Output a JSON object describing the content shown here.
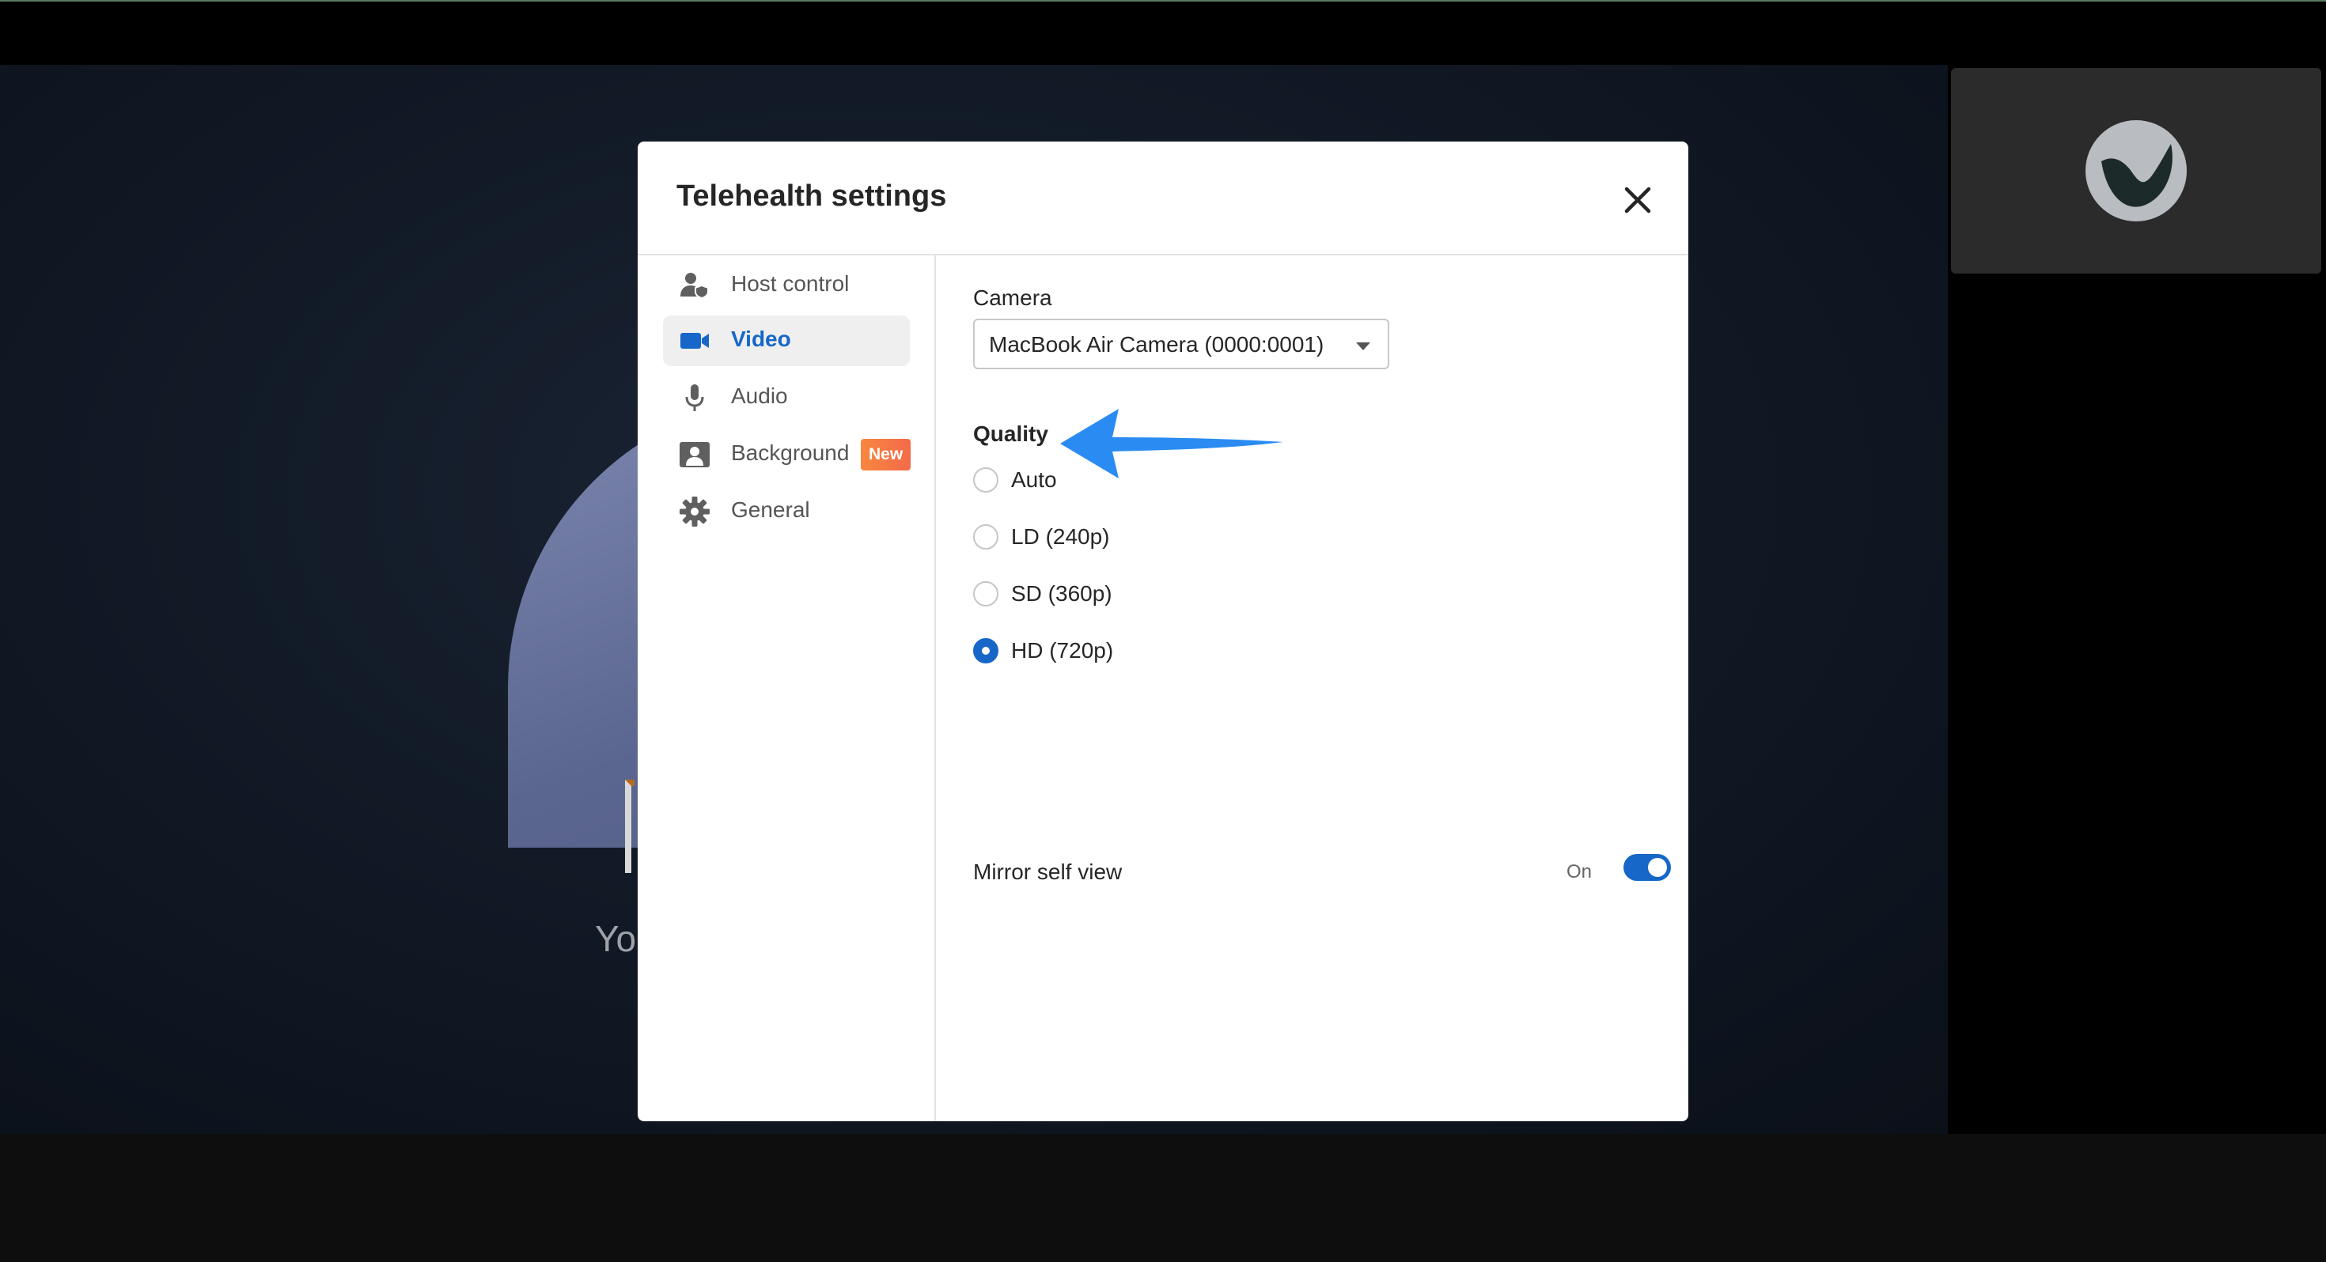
{
  "background": {
    "caption_fragment": "Yo"
  },
  "modal": {
    "title": "Telehealth settings"
  },
  "sidebar": {
    "items": [
      {
        "label": "Host control",
        "icon": "host-control-icon",
        "active": false
      },
      {
        "label": "Video",
        "icon": "video-camera-icon",
        "active": true
      },
      {
        "label": "Audio",
        "icon": "microphone-icon",
        "active": false
      },
      {
        "label": "Background",
        "icon": "background-portrait-icon",
        "active": false,
        "badge": "New"
      },
      {
        "label": "General",
        "icon": "gear-icon",
        "active": false
      }
    ]
  },
  "video": {
    "camera_label": "Camera",
    "camera_value": "MacBook Air Camera (0000:0001)",
    "quality_label": "Quality",
    "quality_options": [
      {
        "label": "Auto",
        "checked": false
      },
      {
        "label": "LD (240p)",
        "checked": false
      },
      {
        "label": "SD (360p)",
        "checked": false
      },
      {
        "label": "HD (720p)",
        "checked": true
      }
    ],
    "mirror_label": "Mirror self view",
    "mirror_state": "On"
  },
  "colors": {
    "accent": "#1667c8",
    "badge": "#f7873f",
    "annotation_arrow": "#2a8cf2"
  }
}
